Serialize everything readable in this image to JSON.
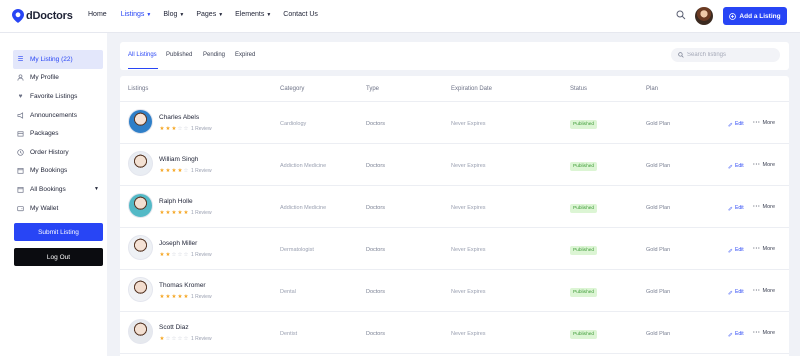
{
  "colors": {
    "accent": "#2845f5",
    "star": "#f5a623",
    "star_empty": "#c9ccd6",
    "published_bg": "#dcf5d4",
    "published_text": "#3e9b38"
  },
  "header": {
    "logo_text": "dDoctors",
    "nav": [
      {
        "label": "Home",
        "caret": ""
      },
      {
        "label": "Listings",
        "caret": "▼"
      },
      {
        "label": "Blog",
        "caret": "▼"
      },
      {
        "label": "Pages",
        "caret": "▼"
      },
      {
        "label": "Elements",
        "caret": "▼"
      },
      {
        "label": "Contact Us",
        "caret": ""
      }
    ],
    "add_listing_label": "Add a Listing"
  },
  "sidebar": {
    "items": [
      {
        "label": "My Listing (22)",
        "icon": "list-icon"
      },
      {
        "label": "My Profile",
        "icon": "user-icon"
      },
      {
        "label": "Favorite Listings",
        "icon": "heart-icon"
      },
      {
        "label": "Announcements",
        "icon": "megaphone-icon"
      },
      {
        "label": "Packages",
        "icon": "package-icon"
      },
      {
        "label": "Order History",
        "icon": "clock-icon"
      },
      {
        "label": "My Bookings",
        "icon": "calendar-icon"
      },
      {
        "label": "All Bookings",
        "icon": "calendar-icon"
      },
      {
        "label": "My Wallet",
        "icon": "wallet-icon"
      }
    ],
    "submit_label": "Submit Listing",
    "logout_label": "Log Out"
  },
  "tabs": [
    "All Listings",
    "Published",
    "Pending",
    "Expired"
  ],
  "search": {
    "placeholder": "Search listings"
  },
  "table": {
    "headers": [
      "Listings",
      "Category",
      "Type",
      "Expiration Date",
      "Status",
      "Plan"
    ],
    "edit_label": "Edit",
    "more_label": "More",
    "rows": [
      {
        "name": "Charles Abels",
        "rating": 3,
        "review": "1 Review",
        "category": "Cardiology",
        "type": "Doctors",
        "expiry": "Never Expires",
        "status": "Published",
        "plan": "Gold Plan"
      },
      {
        "name": "William Singh",
        "rating": 4,
        "review": "1 Review",
        "category": "Addiction Medicine",
        "type": "Doctors",
        "expiry": "Never Expires",
        "status": "Published",
        "plan": "Gold Plan"
      },
      {
        "name": "Ralph Holle",
        "rating": 5,
        "review": "1 Review",
        "category": "Addiction Medicine",
        "type": "Doctors",
        "expiry": "Never Expires",
        "status": "Published",
        "plan": "Gold Plan"
      },
      {
        "name": "Joseph Miller",
        "rating": 2,
        "review": "1 Review",
        "category": "Dermatologist",
        "type": "Doctors",
        "expiry": "Never Expires",
        "status": "Published",
        "plan": "Gold Plan"
      },
      {
        "name": "Thomas Kromer",
        "rating": 5,
        "review": "1 Review",
        "category": "Dental",
        "type": "Doctors",
        "expiry": "Never Expires",
        "status": "Published",
        "plan": "Gold Plan"
      },
      {
        "name": "Scott Diaz",
        "rating": 1,
        "review": "1 Review",
        "category": "Dentist",
        "type": "Doctors",
        "expiry": "Never Expires",
        "status": "Published",
        "plan": "Gold Plan"
      }
    ]
  }
}
